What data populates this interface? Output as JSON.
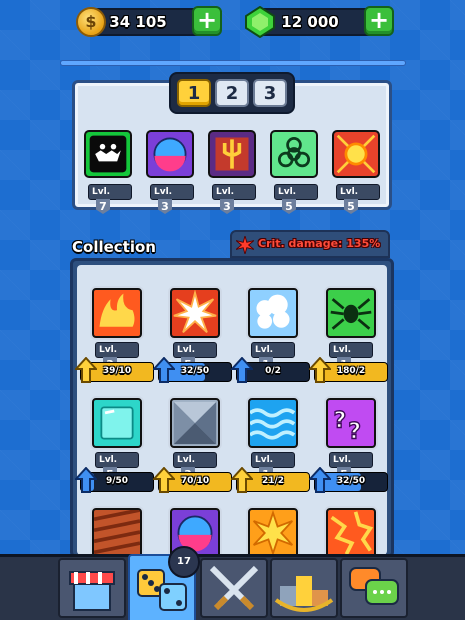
{
  "currency": {
    "coins": {
      "amount": "34 105",
      "icon": "coin-icon",
      "symbol": "$"
    },
    "gems": {
      "amount": "12 000",
      "icon": "gem-icon"
    },
    "add_label": "+"
  },
  "loadout": {
    "tabs": [
      "1",
      "2",
      "3"
    ],
    "active_tab": "1",
    "slots": [
      {
        "icon": "shadow-monster-icon",
        "lvl_label": "Lvl.",
        "level": "7"
      },
      {
        "icon": "potion-orb-icon",
        "lvl_label": "Lvl.",
        "level": "3"
      },
      {
        "icon": "trident-icon",
        "lvl_label": "Lvl.",
        "level": "3"
      },
      {
        "icon": "biohazard-icon",
        "lvl_label": "Lvl.",
        "level": "5"
      },
      {
        "icon": "light-burst-icon",
        "lvl_label": "Lvl.",
        "level": "5"
      }
    ]
  },
  "collection": {
    "title": "Collection",
    "crit_label": "Crit. damage: 135%",
    "cards": [
      {
        "icon": "fire-icon",
        "lvl_label": "Lvl.",
        "level": "3",
        "progress": "39/10",
        "upgrade": "gold"
      },
      {
        "icon": "explosion-icon",
        "lvl_label": "Lvl.",
        "level": "5",
        "progress": "32/50",
        "upgrade": "blue"
      },
      {
        "icon": "cloud-icon",
        "lvl_label": "Lvl.",
        "level": "1",
        "progress": "0/2",
        "upgrade": "blue"
      },
      {
        "icon": "spider-icon",
        "lvl_label": "Lvl.",
        "level": "1",
        "progress": "180/2",
        "upgrade": "gold"
      },
      {
        "icon": "ice-cube-icon",
        "lvl_label": "Lvl.",
        "level": "5",
        "progress": "9/50",
        "upgrade": "blue"
      },
      {
        "icon": "metal-spike-icon",
        "lvl_label": "Lvl.",
        "level": "3",
        "progress": "70/10",
        "upgrade": "gold"
      },
      {
        "icon": "water-wave-icon",
        "lvl_label": "Lvl.",
        "level": "1",
        "progress": "21/2",
        "upgrade": "gold"
      },
      {
        "icon": "mystery-icon",
        "lvl_label": "Lvl.",
        "level": "5",
        "progress": "32/50",
        "upgrade": "blue"
      },
      {
        "icon": "earth-icon"
      },
      {
        "icon": "potion-orb-icon"
      },
      {
        "icon": "sun-blast-icon"
      },
      {
        "icon": "lava-icon"
      }
    ]
  },
  "nav": {
    "items": [
      {
        "name": "shop",
        "icon": "shop-icon"
      },
      {
        "name": "dice",
        "icon": "dice-icon",
        "badge": "17"
      },
      {
        "name": "battle",
        "icon": "crossed-swords-icon"
      },
      {
        "name": "leaderboard",
        "icon": "podium-icon"
      },
      {
        "name": "chat",
        "icon": "chat-icon"
      }
    ]
  },
  "colors": {
    "accent": "#ffd13b",
    "gold": "#f2b820",
    "blue": "#3f8ff2",
    "bg": "#1d6ed1"
  }
}
